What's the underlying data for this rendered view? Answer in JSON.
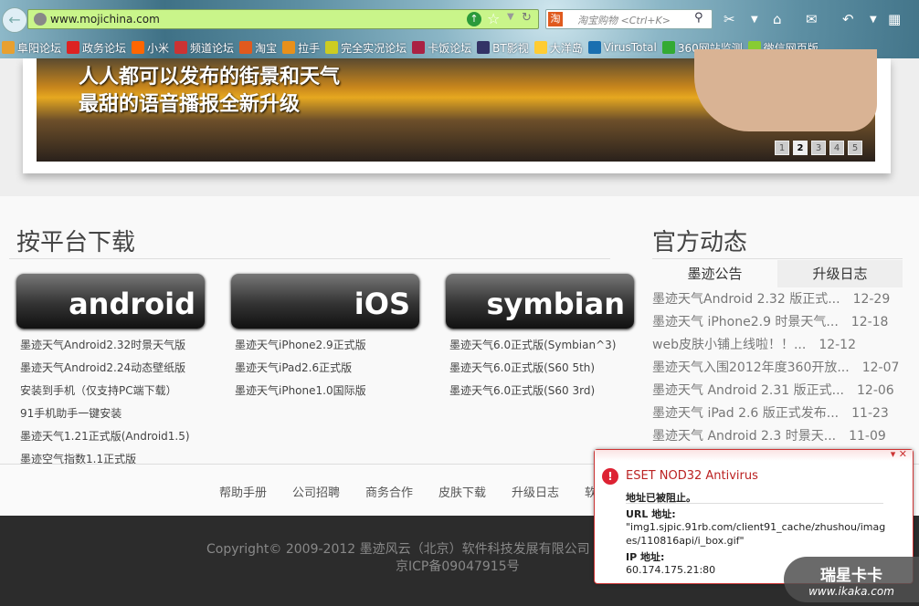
{
  "browser": {
    "url": "www.mojichina.com",
    "search_engine_icon": "淘",
    "search_placeholder": "淘宝购物 <Ctrl+K>",
    "bookmarks": [
      {
        "label": "阜阳论坛",
        "color": "#e8a030"
      },
      {
        "label": "政务论坛",
        "color": "#d22"
      },
      {
        "label": "小米",
        "color": "#f60"
      },
      {
        "label": "频道论坛",
        "color": "#c33"
      },
      {
        "label": "淘宝",
        "color": "#e05a1e"
      },
      {
        "label": "拉手",
        "color": "#e8901a"
      },
      {
        "label": "完全实况论坛",
        "color": "#cc2"
      },
      {
        "label": "卡饭论坛",
        "color": "#a24"
      },
      {
        "label": "BT影视",
        "color": "#336"
      },
      {
        "label": "大洋岛",
        "color": "#fc3"
      },
      {
        "label": "VirusTotal",
        "color": "#1a6fb0"
      },
      {
        "label": "360网站监测",
        "color": "#3a3"
      },
      {
        "label": "微信网页版",
        "color": "#8c3"
      }
    ]
  },
  "banner": {
    "line1": "人人都可以发布的街景和天气",
    "line2": "最甜的语音播报全新升级",
    "pages": [
      "1",
      "2",
      "3",
      "4",
      "5"
    ],
    "active_page": "2"
  },
  "downloads": {
    "heading": "按平台下载",
    "platforms": [
      {
        "name": "android",
        "links": [
          "墨迹天气Android2.32时景天气版",
          "墨迹天气Android2.24动态壁纸版",
          "安装到手机（仅支持PC端下载）",
          "91手机助手一键安装",
          "墨迹天气1.21正式版(Android1.5)",
          "墨迹空气指数1.1正式版"
        ]
      },
      {
        "name": "iOS",
        "links": [
          "墨迹天气iPhone2.9正式版",
          "墨迹天气iPad2.6正式版",
          "墨迹天气iPhone1.0国际版"
        ]
      },
      {
        "name": "symbian",
        "links": [
          "墨迹天气6.0正式版(Symbian^3)",
          "墨迹天气6.0正式版(S60 5th)",
          "墨迹天气6.0正式版(S60 3rd)"
        ]
      }
    ]
  },
  "news": {
    "heading": "官方动态",
    "tabs": [
      "墨迹公告",
      "升级日志"
    ],
    "items": [
      {
        "title": "墨迹天气Android 2.32 版正式...",
        "date": "12-29"
      },
      {
        "title": "墨迹天气 iPhone2.9 时景天气...",
        "date": "12-18"
      },
      {
        "title": "web皮肤小铺上线啦！！...",
        "date": "12-12"
      },
      {
        "title": "墨迹天气入围2012年度360开放...",
        "date": "12-07"
      },
      {
        "title": "墨迹天气 Android 2.31 版正式...",
        "date": "12-06"
      },
      {
        "title": "墨迹天气 iPad 2.6 版正式发布...",
        "date": "11-23"
      },
      {
        "title": "墨迹天气 Android 2.3 时景天...",
        "date": "11-09"
      }
    ]
  },
  "footer": {
    "links": [
      "帮助手册",
      "公司招聘",
      "商务合作",
      "皮肤下载",
      "升级日志",
      "软"
    ],
    "copyright": "Copyright© 2009-2012 墨迹风云（北京）软件科技发展有限公司 A",
    "icp": "京ICP备09047915号"
  },
  "popup": {
    "title": "ESET NOD32 Antivirus",
    "blocked": "地址已被阻止。",
    "url_label": "URL 地址:",
    "url_line1": "\"img1.sjpic.91rb.com/client91_cache/zhushou/imag",
    "url_line2": "es/110816api/i_box.gif\"",
    "ip_label": "IP 地址:",
    "ip": "60.174.175.21:80"
  },
  "watermark": {
    "brand": "瑞星卡卡",
    "site": "www.ikaka.com"
  }
}
